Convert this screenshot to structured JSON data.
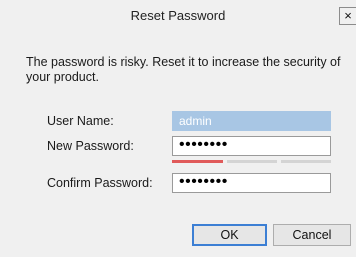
{
  "dialog": {
    "title": "Reset Password",
    "close_label": "×",
    "message": "The password is risky. Reset it to increase the security of your product."
  },
  "form": {
    "username_label": "User Name:",
    "username_value": "admin",
    "new_password_label": "New Password:",
    "new_password_value": "••••••••",
    "confirm_password_label": "Confirm Password:",
    "confirm_password_value": "••••••••",
    "strength": {
      "level": 1,
      "max": 3,
      "active_color": "#e05a5a",
      "inactive_color": "#d4d4d4"
    }
  },
  "buttons": {
    "ok_label": "OK",
    "cancel_label": "Cancel"
  },
  "colors": {
    "background": "#f0f0f0",
    "focus_border": "#3c7fd4",
    "disabled_field": "#a8c6e4"
  }
}
